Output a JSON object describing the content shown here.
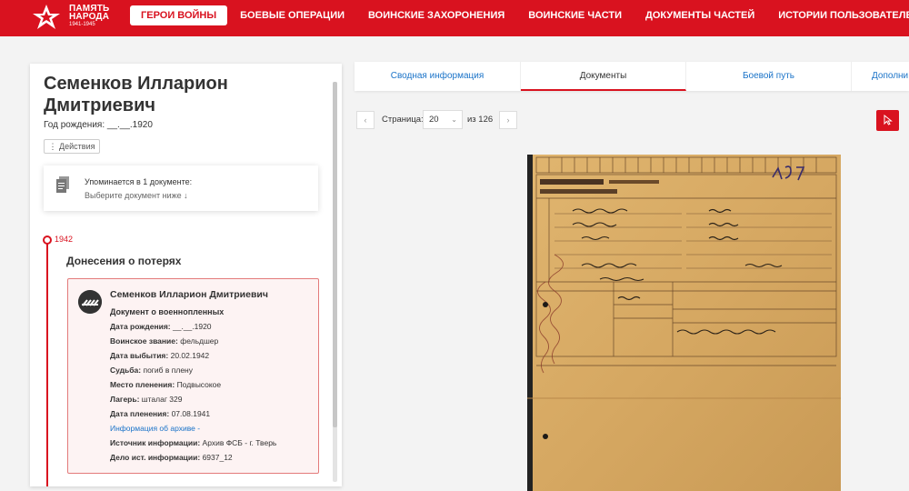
{
  "header": {
    "logo_line1": "ПАМЯТЬ",
    "logo_line2": "НАРОДА",
    "logo_years": "1941-1945",
    "nav": [
      {
        "label": "ГЕРОИ ВОЙНЫ",
        "active": true
      },
      {
        "label": "БОЕВЫЕ ОПЕРАЦИИ"
      },
      {
        "label": "ВОИНСКИЕ ЗАХОРОНЕНИЯ"
      },
      {
        "label": "ВОИНСКИЕ ЧАСТИ"
      },
      {
        "label": "ДОКУМЕНТЫ ЧАСТЕЙ"
      },
      {
        "label": "ИСТОРИИ ПОЛЬЗОВАТЕЛЕЙ"
      }
    ],
    "brand_color": "#d9121f"
  },
  "person": {
    "name": "Семенков Илларион Дмитриевич",
    "birth": "Год рождения: __.__.1920",
    "actions_label": "⋮ Действия"
  },
  "mention": {
    "title": "Упоминается в 1 документе:",
    "subtitle": "Выберите документ ниже ↓"
  },
  "timeline": {
    "year": "1942",
    "section_title": "Донесения о потерях"
  },
  "record": {
    "name": "Семенков Илларион Дмитриевич",
    "doc_type": "Документ о военнопленных",
    "fields": [
      {
        "label": "Дата рождения:",
        "value": "__.__.1920"
      },
      {
        "label": "Воинское звание:",
        "value": "фельдшер"
      },
      {
        "label": "Дата выбытия:",
        "value": "20.02.1942"
      },
      {
        "label": "Судьба:",
        "value": "погиб в плену"
      },
      {
        "label": "Место пленения:",
        "value": "Подвысокое"
      },
      {
        "label": "Лагерь:",
        "value": "шталаг 329"
      },
      {
        "label": "Дата пленения:",
        "value": "07.08.1941"
      }
    ],
    "archive_link": "Информация об архиве -",
    "fields2": [
      {
        "label": "Источник информации:",
        "value": "Архив ФСБ - г. Тверь"
      },
      {
        "label": "Дело ист. информации:",
        "value": "6937_12"
      }
    ]
  },
  "tabs": [
    {
      "label": "Сводная информация"
    },
    {
      "label": "Документы",
      "active": true
    },
    {
      "label": "Боевой путь"
    },
    {
      "label": "Дополни"
    }
  ],
  "pager": {
    "prev": "‹",
    "next": "›",
    "page_label": "Страница:",
    "page_value": "20",
    "of_label": "из 126"
  },
  "icons": {
    "star": "star-logo-icon",
    "document": "document-icon",
    "org": "organization-icon",
    "tool": "cursor-icon"
  }
}
